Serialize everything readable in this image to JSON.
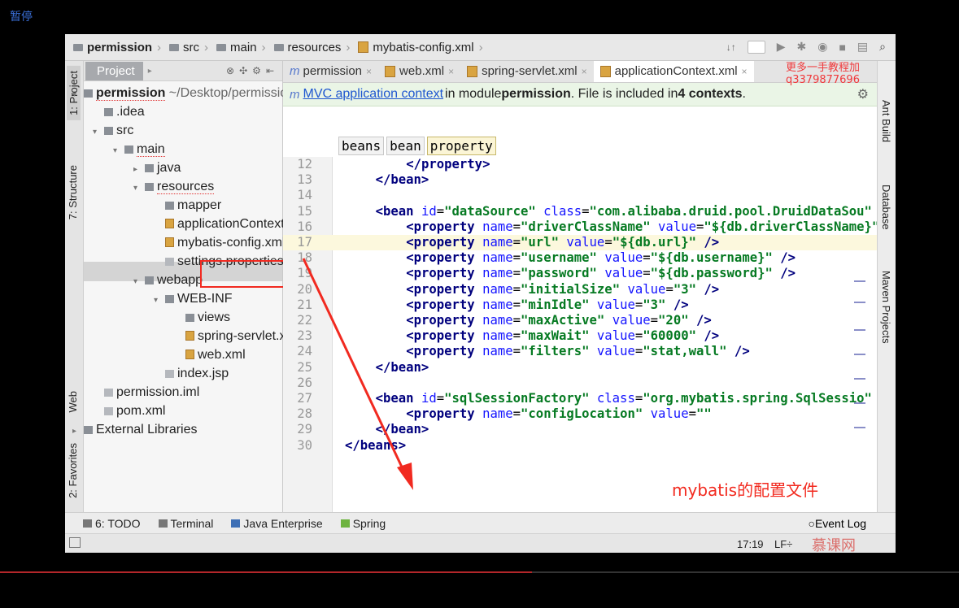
{
  "overlay": {
    "pause_label": "暂停",
    "watermark": "更多一手教程加q3379877696",
    "annotation": "mybatis的配置文件"
  },
  "navbar": {
    "crumbs": [
      "permission",
      "src",
      "main",
      "resources",
      "mybatis-config.xml"
    ]
  },
  "left_stripe": {
    "tabs": [
      "1: Project",
      "7: Structure",
      "Web",
      "2: Favorites"
    ]
  },
  "right_stripe": {
    "tabs": [
      "Ant Build",
      "Database",
      "Maven Projects"
    ]
  },
  "project_panel": {
    "tab": "Project",
    "tree": [
      {
        "label": "permission",
        "suffix": "~/Desktop/permission",
        "icon": "module-icon"
      },
      {
        "label": ".idea",
        "icon": "folder-icon"
      },
      {
        "label": "src",
        "icon": "folder-icon"
      },
      {
        "label": "main",
        "icon": "folder-icon"
      },
      {
        "label": "java",
        "icon": "folder-icon"
      },
      {
        "label": "resources",
        "icon": "folder-icon"
      },
      {
        "label": "mapper",
        "icon": "folder-icon"
      },
      {
        "label": "applicationContext.xml",
        "icon": "xml-file-icon"
      },
      {
        "label": "mybatis-config.xml",
        "icon": "xml-file-icon"
      },
      {
        "label": "settings.properties",
        "icon": "properties-file-icon"
      },
      {
        "label": "webapp",
        "icon": "folder-icon"
      },
      {
        "label": "WEB-INF",
        "icon": "folder-icon"
      },
      {
        "label": "views",
        "icon": "folder-icon"
      },
      {
        "label": "spring-servlet.xml",
        "icon": "xml-file-icon"
      },
      {
        "label": "web.xml",
        "icon": "xml-file-icon"
      },
      {
        "label": "index.jsp",
        "icon": "jsp-file-icon"
      },
      {
        "label": "permission.iml",
        "icon": "iml-file-icon"
      },
      {
        "label": "pom.xml",
        "icon": "maven-file-icon"
      },
      {
        "label": "External Libraries",
        "icon": "library-icon"
      }
    ],
    "selected": "mybatis-config.xml"
  },
  "editor": {
    "tabs": [
      "permission",
      "web.xml",
      "spring-servlet.xml",
      "applicationContext.xml"
    ],
    "active_tab": "applicationContext.xml",
    "info_bar": {
      "link": "MVC application context",
      "text1": " in module ",
      "module": "permission",
      "text2": ". File is included in ",
      "contexts": "4 contexts",
      "text3": "."
    },
    "breadcrumbs": [
      "beans",
      "bean",
      "property"
    ],
    "lines": [
      {
        "n": "12",
        "indent": 8,
        "kind": "close",
        "tag": "property"
      },
      {
        "n": "13",
        "indent": 4,
        "kind": "close",
        "tag": "bean"
      },
      {
        "n": "14",
        "indent": 0,
        "kind": "blank"
      },
      {
        "n": "15",
        "indent": 4,
        "kind": "open",
        "tag": "bean",
        "attrs": [
          [
            "id",
            "dataSource"
          ],
          [
            "class",
            "com.alibaba.druid.pool.DruidDataSou"
          ]
        ],
        "end": ""
      },
      {
        "n": "16",
        "indent": 8,
        "kind": "open",
        "tag": "property",
        "attrs": [
          [
            "name",
            "driverClassName"
          ],
          [
            "value",
            "${db.driverClassName}"
          ]
        ],
        "end": ""
      },
      {
        "n": "17",
        "indent": 8,
        "kind": "open",
        "tag": "property",
        "attrs": [
          [
            "name",
            "url"
          ],
          [
            "value",
            "${db.url}"
          ]
        ],
        "end": " />",
        "hl": true
      },
      {
        "n": "18",
        "indent": 8,
        "kind": "open",
        "tag": "property",
        "attrs": [
          [
            "name",
            "username"
          ],
          [
            "value",
            "${db.username}"
          ]
        ],
        "end": " />"
      },
      {
        "n": "19",
        "indent": 8,
        "kind": "open",
        "tag": "property",
        "attrs": [
          [
            "name",
            "password"
          ],
          [
            "value",
            "${db.password}"
          ]
        ],
        "end": " />"
      },
      {
        "n": "20",
        "indent": 8,
        "kind": "open",
        "tag": "property",
        "attrs": [
          [
            "name",
            "initialSize"
          ],
          [
            "value",
            "3"
          ]
        ],
        "end": " />"
      },
      {
        "n": "21",
        "indent": 8,
        "kind": "open",
        "tag": "property",
        "attrs": [
          [
            "name",
            "minIdle"
          ],
          [
            "value",
            "3"
          ]
        ],
        "end": " />"
      },
      {
        "n": "22",
        "indent": 8,
        "kind": "open",
        "tag": "property",
        "attrs": [
          [
            "name",
            "maxActive"
          ],
          [
            "value",
            "20"
          ]
        ],
        "end": " />"
      },
      {
        "n": "23",
        "indent": 8,
        "kind": "open",
        "tag": "property",
        "attrs": [
          [
            "name",
            "maxWait"
          ],
          [
            "value",
            "60000"
          ]
        ],
        "end": " />"
      },
      {
        "n": "24",
        "indent": 8,
        "kind": "open",
        "tag": "property",
        "attrs": [
          [
            "name",
            "filters"
          ],
          [
            "value",
            "stat,wall"
          ]
        ],
        "end": " />"
      },
      {
        "n": "25",
        "indent": 4,
        "kind": "close",
        "tag": "bean"
      },
      {
        "n": "26",
        "indent": 0,
        "kind": "blank"
      },
      {
        "n": "27",
        "indent": 4,
        "kind": "open",
        "tag": "bean",
        "attrs": [
          [
            "id",
            "sqlSessionFactory"
          ],
          [
            "class",
            "org.mybatis.spring.SqlSessio"
          ]
        ],
        "end": ""
      },
      {
        "n": "28",
        "indent": 8,
        "kind": "open",
        "tag": "property",
        "attrs": [
          [
            "name",
            "configLocation"
          ],
          [
            "value",
            ""
          ]
        ],
        "end": ""
      },
      {
        "n": "29",
        "indent": 4,
        "kind": "close",
        "tag": "bean"
      },
      {
        "n": "30",
        "indent": 0,
        "kind": "close",
        "tag": "beans"
      }
    ]
  },
  "bottom_bar": {
    "items": [
      {
        "label": "6: TODO",
        "icon": "todo-icon"
      },
      {
        "label": "Terminal",
        "icon": "terminal-icon"
      },
      {
        "label": "Java Enterprise",
        "icon": "java-enterprise-icon"
      },
      {
        "label": "Spring",
        "icon": "spring-icon"
      }
    ],
    "event_log": "Event Log"
  },
  "status_bar": {
    "position": "17:19",
    "line_sep": "LF÷",
    "logo": "慕课网"
  },
  "video": {
    "progress": 0.555
  },
  "colors": {
    "accent_red": "#f12a20",
    "tag": "#00007e",
    "value": "#067a22",
    "attr": "#1515ff"
  }
}
